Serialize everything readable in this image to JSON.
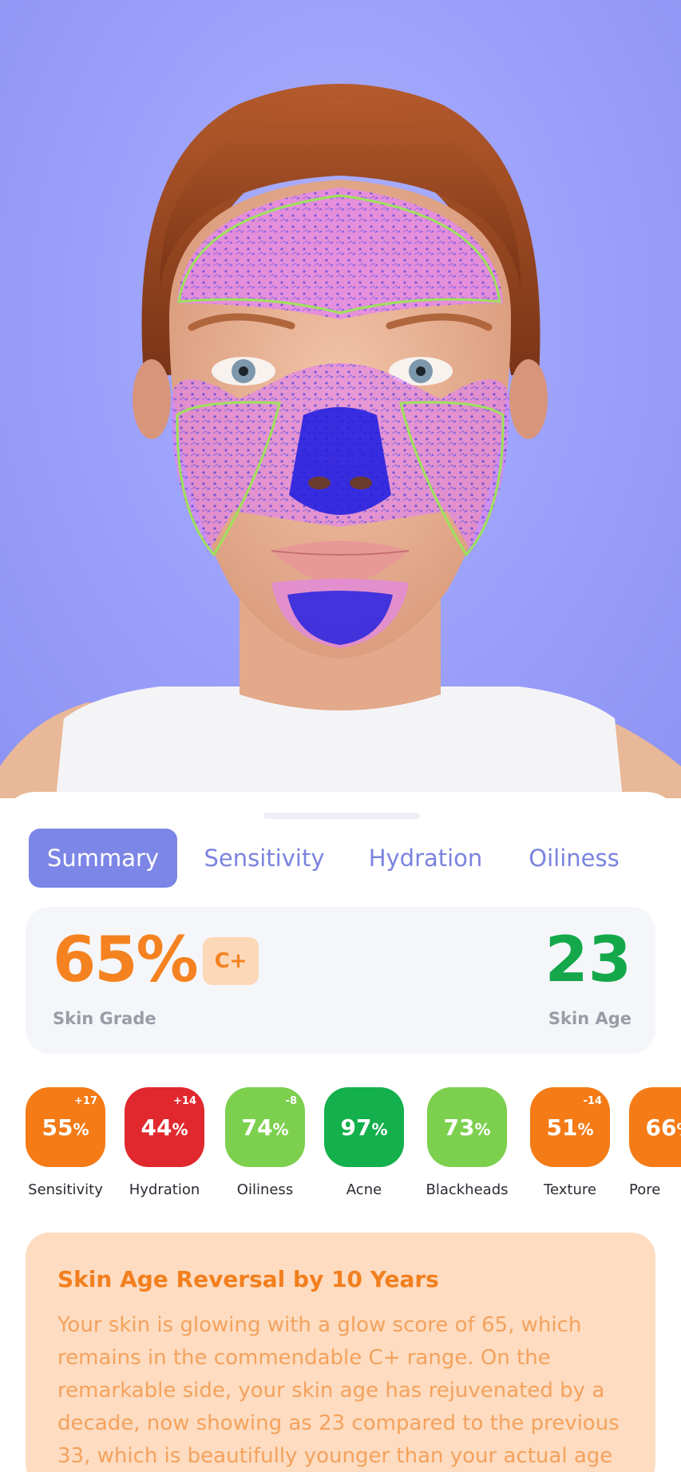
{
  "tabs": [
    {
      "label": "Summary",
      "active": true
    },
    {
      "label": "Sensitivity",
      "active": false
    },
    {
      "label": "Hydration",
      "active": false
    },
    {
      "label": "Oiliness",
      "active": false
    }
  ],
  "grade": {
    "value": "65%",
    "letter": "C+",
    "label": "Skin Grade",
    "age_value": "23",
    "age_label": "Skin Age"
  },
  "metrics": [
    {
      "name": "Sensitivity",
      "value": "55",
      "unit": "%",
      "delta": "+17",
      "color": "#f47b16"
    },
    {
      "name": "Hydration",
      "value": "44",
      "unit": "%",
      "delta": "+14",
      "color": "#e0282e"
    },
    {
      "name": "Oiliness",
      "value": "74",
      "unit": "%",
      "delta": "-8",
      "color": "#7cd04e"
    },
    {
      "name": "Acne",
      "value": "97",
      "unit": "%",
      "delta": "",
      "color": "#13b04c"
    },
    {
      "name": "Blackheads",
      "value": "73",
      "unit": "%",
      "delta": "",
      "color": "#7cd04e"
    },
    {
      "name": "Texture",
      "value": "51",
      "unit": "%",
      "delta": "-14",
      "color": "#f47b16"
    },
    {
      "name": "Pore",
      "value": "66",
      "unit": "%",
      "delta": "",
      "color": "#f47b16"
    }
  ],
  "insight": {
    "title": "Skin Age Reversal by 10 Years",
    "body": "Your skin is glowing with a glow score of 65, which remains in the commendable C+ range. On the remarkable side, your skin age has rejuvenated by a decade, now showing as 23 compared to the previous 33, which is beautifully younger than your actual age"
  },
  "colors": {
    "accent": "#7c86e6",
    "grade": "#f58220",
    "age": "#14a84b",
    "insight_bg": "#fddcc1"
  }
}
